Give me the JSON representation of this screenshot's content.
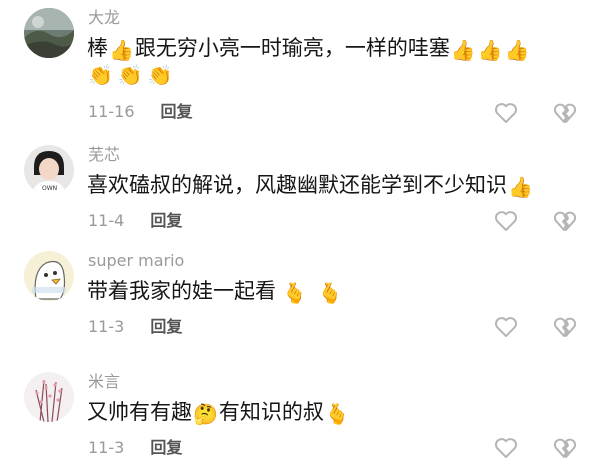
{
  "comments": [
    {
      "username": "大龙",
      "text_parts": [
        "棒",
        "跟无穷小亮一时瑜亮，一样的哇塞"
      ],
      "emojis": {
        "thumbs_up": "👍",
        "clap": "👏",
        "heart_hands": "🫰",
        "thinking": "🤔"
      },
      "date": "11-16",
      "reply_label": "回复"
    },
    {
      "username": "芜芯",
      "text": "喜欢磕叔的解说，风趣幽默还能学到不少知识",
      "date": "11-4",
      "reply_label": "回复"
    },
    {
      "username": "super mario",
      "text": "带着我家的娃一起看",
      "date": "11-3",
      "reply_label": "回复"
    },
    {
      "username": "米言",
      "text_parts": [
        "又帅有有趣",
        "有知识的叔"
      ],
      "date": "11-3",
      "reply_label": "回复"
    }
  ],
  "icons": [
    "like-heart-icon",
    "dislike-broken-heart-icon"
  ],
  "colors": {
    "username": "#9a9a9a",
    "text": "#161616",
    "reply": "#555555",
    "icon": "#b5b5b5"
  }
}
